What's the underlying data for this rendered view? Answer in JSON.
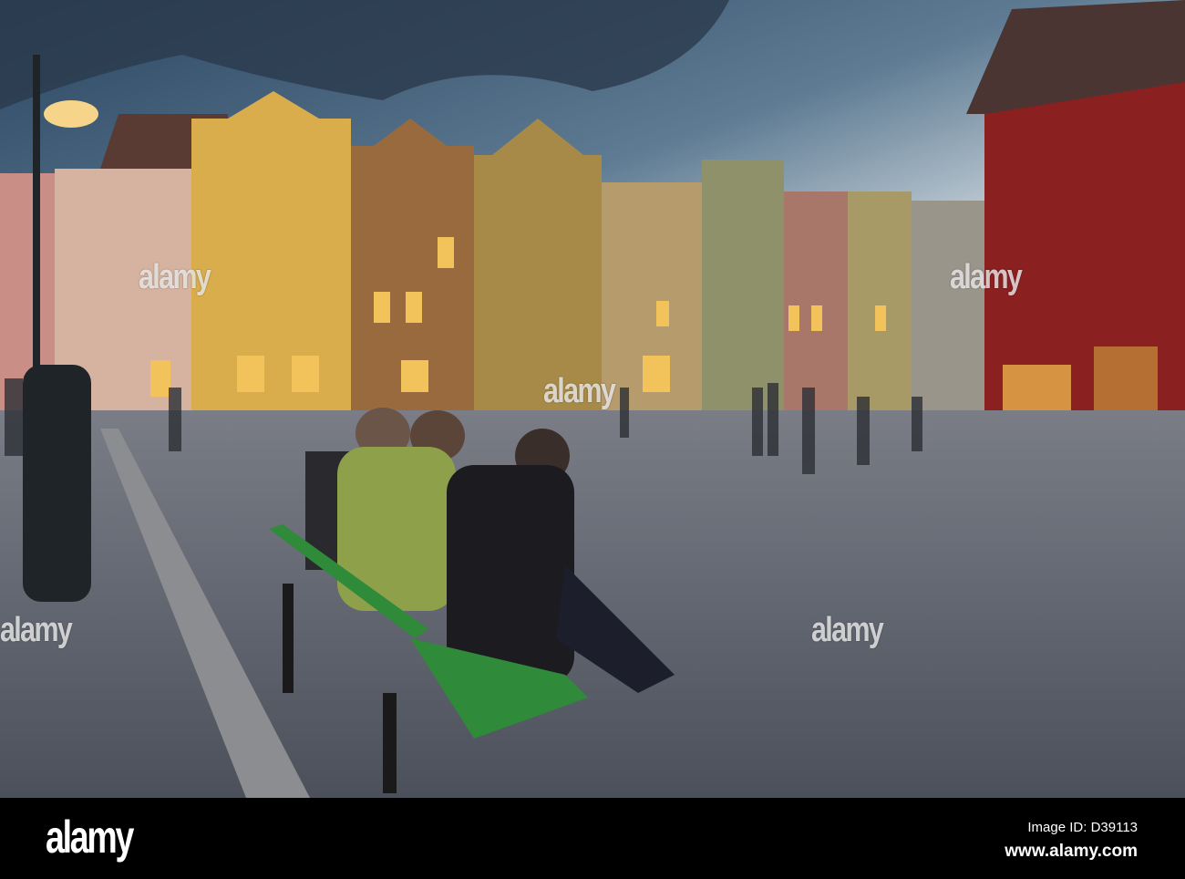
{
  "watermark": {
    "text": "alamy"
  },
  "footer": {
    "logo": "alamy",
    "image_id": "Image ID: D39113",
    "url": "www.alamy.com"
  },
  "colors": {
    "sky_top": "#2f4a63",
    "sky_light": "#c9d4da",
    "cobble": "#5d6470",
    "bench": "#2f8a3a",
    "red_building": "#8a2020"
  }
}
